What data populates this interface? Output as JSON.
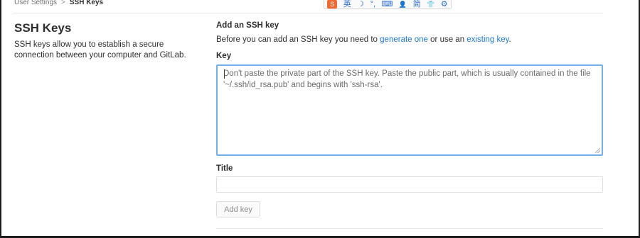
{
  "breadcrumb": {
    "parent": "User Settings",
    "separator": ">",
    "current": "SSH Keys"
  },
  "ime_toolbar": {
    "logo": "S",
    "items": [
      "英",
      "☽",
      "°,",
      "⌨",
      "👤",
      "简",
      "👕",
      "⚙"
    ],
    "icons": [
      "sogou-logo-icon",
      "english-mode-icon",
      "moon-icon",
      "punctuation-icon",
      "keyboard-icon",
      "user-icon",
      "simplified-chinese-icon",
      "skin-icon",
      "settings-gear-icon"
    ]
  },
  "sidebar": {
    "title": "SSH Keys",
    "description": "SSH keys allow you to establish a secure connection between your computer and GitLab."
  },
  "form": {
    "section_title": "Add an SSH key",
    "intro_prefix": "Before you can add an SSH key you need to ",
    "generate_link": "generate one",
    "intro_middle": " or use an ",
    "existing_link": "existing key",
    "intro_suffix": ".",
    "key_label": "Key",
    "key_placeholder": "Don't paste the private part of the SSH key. Paste the public part, which is usually contained in the file '~/.ssh/id_rsa.pub' and begins with 'ssh-rsa'.",
    "title_label": "Title",
    "title_value": "",
    "add_button": "Add key"
  },
  "colors": {
    "link": "#1f78d1",
    "focus_border": "#73afea",
    "ime_orange": "#f06a35"
  }
}
